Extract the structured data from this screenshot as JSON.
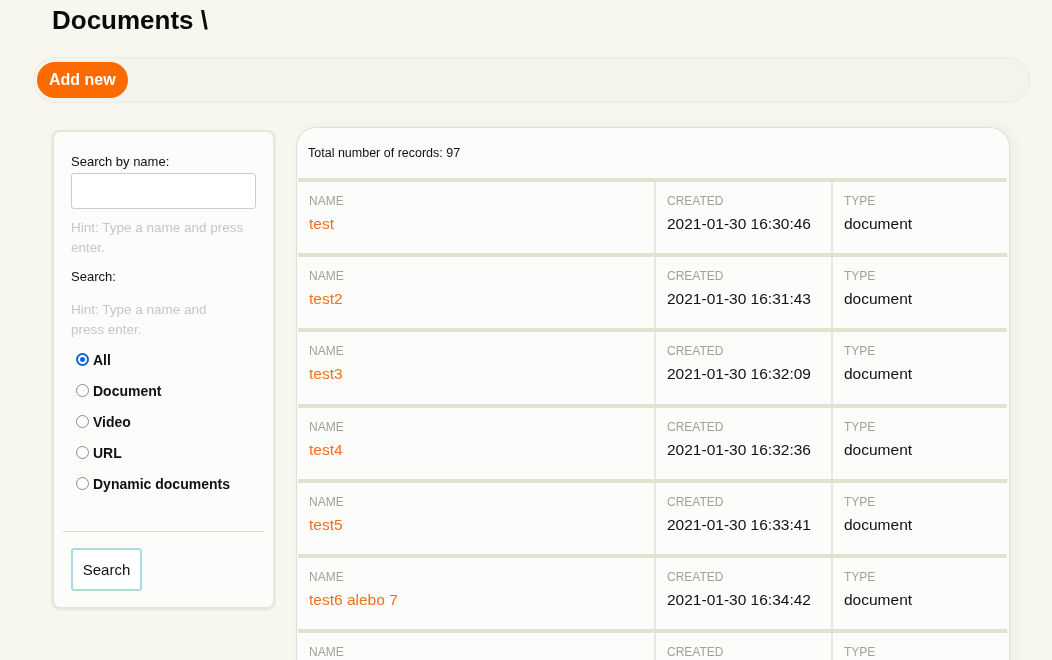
{
  "page": {
    "title": "Documents \\"
  },
  "toolbar": {
    "add_button": "Add new"
  },
  "search_panel": {
    "name_label": "Search by name:",
    "name_hint": "Hint: Type a name and press enter.",
    "search_label": "Search:",
    "search_hint": "Hint: Type a name and press enter.",
    "filters": [
      {
        "label": "All",
        "selected": true
      },
      {
        "label": "Document",
        "selected": false
      },
      {
        "label": "Video",
        "selected": false
      },
      {
        "label": "URL",
        "selected": false
      },
      {
        "label": "Dynamic documents",
        "selected": false
      }
    ],
    "search_button": "Search"
  },
  "records": {
    "total": "Total number of records: 97",
    "rows": [
      {
        "cells": [
          {
            "kind": "link",
            "label": "NAME",
            "value": "test"
          },
          {
            "kind": "text",
            "label": "CREATED",
            "value": "2021-01-30 16:30:46"
          },
          {
            "kind": "text",
            "label": "TYPE",
            "value": "document"
          }
        ]
      },
      {
        "cells": [
          {
            "kind": "link",
            "label": "NAME",
            "value": "test2"
          },
          {
            "kind": "text",
            "label": "CREATED",
            "value": "2021-01-30 16:31:43"
          },
          {
            "kind": "text",
            "label": "TYPE",
            "value": "document"
          }
        ]
      },
      {
        "cells": [
          {
            "kind": "link",
            "label": "NAME",
            "value": "test3"
          },
          {
            "kind": "text",
            "label": "CREATED",
            "value": "2021-01-30 16:32:09"
          },
          {
            "kind": "text",
            "label": "TYPE",
            "value": "document"
          }
        ]
      },
      {
        "cells": [
          {
            "kind": "link",
            "label": "NAME",
            "value": "test4"
          },
          {
            "kind": "text",
            "label": "CREATED",
            "value": "2021-01-30 16:32:36"
          },
          {
            "kind": "text",
            "label": "TYPE",
            "value": "document"
          }
        ]
      },
      {
        "cells": [
          {
            "kind": "link",
            "label": "NAME",
            "value": "test5"
          },
          {
            "kind": "text",
            "label": "CREATED",
            "value": "2021-01-30 16:33:41"
          },
          {
            "kind": "text",
            "label": "TYPE",
            "value": "document"
          }
        ]
      },
      {
        "cells": [
          {
            "kind": "link",
            "label": "NAME",
            "value": "test6 alebo 7"
          },
          {
            "kind": "text",
            "label": "CREATED",
            "value": "2021-01-30 16:34:42"
          },
          {
            "kind": "text",
            "label": "TYPE",
            "value": "document"
          }
        ]
      },
      {
        "cells": [
          {
            "label": "NAME"
          },
          {
            "label": "CREATED"
          },
          {
            "label": "TYPE"
          }
        ]
      }
    ]
  }
}
